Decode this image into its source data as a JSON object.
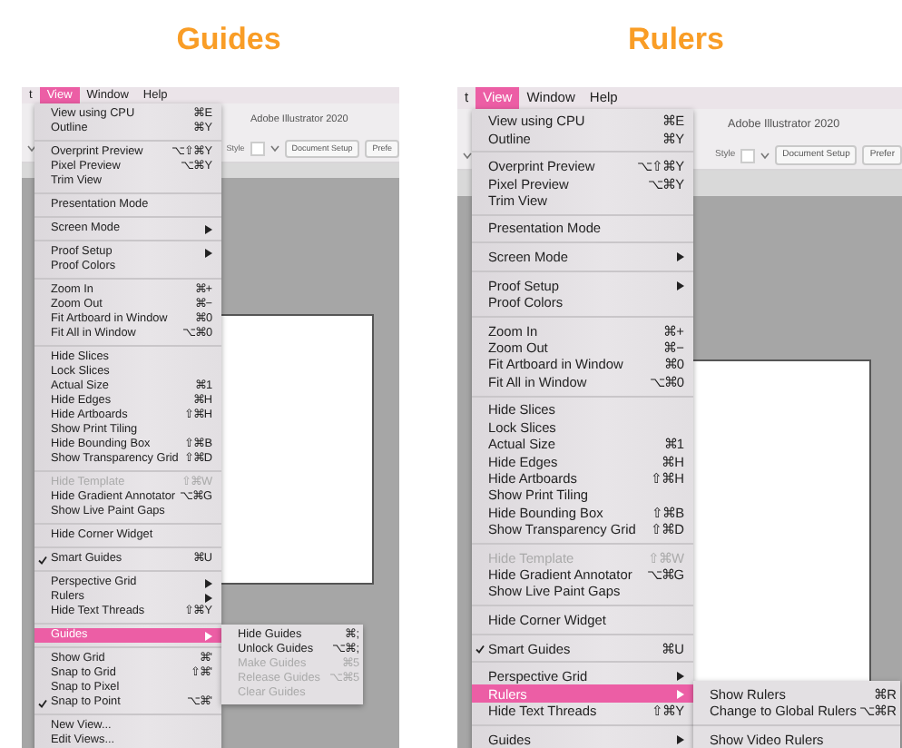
{
  "panels": [
    {
      "title": "Guides",
      "menubar": [
        {
          "label": "t",
          "selected": false
        },
        {
          "label": "View",
          "selected": true
        },
        {
          "label": "Window",
          "selected": false
        },
        {
          "label": "Help",
          "selected": false
        }
      ],
      "app": {
        "title": "Adobe Illustrator 2020",
        "style_label": "Style",
        "buttons": [
          "Document Setup",
          "Prefe"
        ]
      },
      "menu": [
        [
          {
            "label": "View using CPU",
            "shortcut": "⌘E"
          },
          {
            "label": "Outline",
            "shortcut": "⌘Y"
          }
        ],
        [
          {
            "label": "Overprint Preview",
            "shortcut": "⌥⇧⌘Y"
          },
          {
            "label": "Pixel Preview",
            "shortcut": "⌥⌘Y"
          },
          {
            "label": "Trim View"
          }
        ],
        [
          {
            "label": "Presentation Mode"
          }
        ],
        [
          {
            "label": "Screen Mode",
            "has_submenu": true
          }
        ],
        [
          {
            "label": "Proof Setup",
            "has_submenu": true
          },
          {
            "label": "Proof Colors"
          }
        ],
        [
          {
            "label": "Zoom In",
            "shortcut": "⌘+"
          },
          {
            "label": "Zoom Out",
            "shortcut": "⌘−"
          },
          {
            "label": "Fit Artboard in Window",
            "shortcut": "⌘0"
          },
          {
            "label": "Fit All in Window",
            "shortcut": "⌥⌘0"
          }
        ],
        [
          {
            "label": "Hide Slices"
          },
          {
            "label": "Lock Slices"
          },
          {
            "label": "Actual Size",
            "shortcut": "⌘1"
          },
          {
            "label": "Hide Edges",
            "shortcut": "⌘H"
          },
          {
            "label": "Hide Artboards",
            "shortcut": "⇧⌘H"
          },
          {
            "label": "Show Print Tiling"
          },
          {
            "label": "Hide Bounding Box",
            "shortcut": "⇧⌘B"
          },
          {
            "label": "Show Transparency Grid",
            "shortcut": "⇧⌘D"
          }
        ],
        [
          {
            "label": "Hide Template",
            "shortcut": "⇧⌘W",
            "disabled": true
          },
          {
            "label": "Hide Gradient Annotator",
            "shortcut": "⌥⌘G"
          },
          {
            "label": "Show Live Paint Gaps"
          }
        ],
        [
          {
            "label": "Hide Corner Widget"
          }
        ],
        [
          {
            "label": "Smart Guides",
            "shortcut": "⌘U",
            "checked": true
          }
        ],
        [
          {
            "label": "Perspective Grid",
            "has_submenu": true
          },
          {
            "label": "Rulers",
            "has_submenu": true
          },
          {
            "label": "Hide Text Threads",
            "shortcut": "⇧⌘Y"
          }
        ],
        [
          {
            "label": "Guides",
            "has_submenu": true,
            "selected": true
          }
        ],
        [
          {
            "label": "Show Grid",
            "shortcut": "⌘'"
          },
          {
            "label": "Snap to Grid",
            "shortcut": "⇧⌘'"
          },
          {
            "label": "Snap to Pixel"
          },
          {
            "label": "Snap to Point",
            "shortcut": "⌥⌘'",
            "checked": true
          }
        ],
        [
          {
            "label": "New View..."
          },
          {
            "label": "Edit Views..."
          }
        ]
      ],
      "submenu": [
        [
          {
            "label": "Hide Guides",
            "shortcut": "⌘;"
          },
          {
            "label": "Unlock Guides",
            "shortcut": "⌥⌘;"
          },
          {
            "label": "Make Guides",
            "shortcut": "⌘5",
            "disabled": true
          },
          {
            "label": "Release Guides",
            "shortcut": "⌥⌘5",
            "disabled": true
          },
          {
            "label": "Clear Guides",
            "disabled": true
          }
        ]
      ]
    },
    {
      "title": "Rulers",
      "menubar": [
        {
          "label": "t",
          "selected": false
        },
        {
          "label": "View",
          "selected": true
        },
        {
          "label": "Window",
          "selected": false
        },
        {
          "label": "Help",
          "selected": false
        }
      ],
      "app": {
        "title": "Adobe Illustrator 2020",
        "style_label": "Style",
        "buttons": [
          "Document Setup",
          "Prefer"
        ]
      },
      "menu": [
        [
          {
            "label": "View using CPU",
            "shortcut": "⌘E"
          },
          {
            "label": "Outline",
            "shortcut": "⌘Y"
          }
        ],
        [
          {
            "label": "Overprint Preview",
            "shortcut": "⌥⇧⌘Y"
          },
          {
            "label": "Pixel Preview",
            "shortcut": "⌥⌘Y"
          },
          {
            "label": "Trim View"
          }
        ],
        [
          {
            "label": "Presentation Mode"
          }
        ],
        [
          {
            "label": "Screen Mode",
            "has_submenu": true
          }
        ],
        [
          {
            "label": "Proof Setup",
            "has_submenu": true
          },
          {
            "label": "Proof Colors"
          }
        ],
        [
          {
            "label": "Zoom In",
            "shortcut": "⌘+"
          },
          {
            "label": "Zoom Out",
            "shortcut": "⌘−"
          },
          {
            "label": "Fit Artboard in Window",
            "shortcut": "⌘0"
          },
          {
            "label": "Fit All in Window",
            "shortcut": "⌥⌘0"
          }
        ],
        [
          {
            "label": "Hide Slices"
          },
          {
            "label": "Lock Slices"
          },
          {
            "label": "Actual Size",
            "shortcut": "⌘1"
          },
          {
            "label": "Hide Edges",
            "shortcut": "⌘H"
          },
          {
            "label": "Hide Artboards",
            "shortcut": "⇧⌘H"
          },
          {
            "label": "Show Print Tiling"
          },
          {
            "label": "Hide Bounding Box",
            "shortcut": "⇧⌘B"
          },
          {
            "label": "Show Transparency Grid",
            "shortcut": "⇧⌘D"
          }
        ],
        [
          {
            "label": "Hide Template",
            "shortcut": "⇧⌘W",
            "disabled": true
          },
          {
            "label": "Hide Gradient Annotator",
            "shortcut": "⌥⌘G"
          },
          {
            "label": "Show Live Paint Gaps"
          }
        ],
        [
          {
            "label": "Hide Corner Widget"
          }
        ],
        [
          {
            "label": "Smart Guides",
            "shortcut": "⌘U",
            "checked": true
          }
        ],
        [
          {
            "label": "Perspective Grid",
            "has_submenu": true
          },
          {
            "label": "Rulers",
            "has_submenu": true,
            "selected": true
          },
          {
            "label": "Hide Text Threads",
            "shortcut": "⇧⌘Y"
          }
        ],
        [
          {
            "label": "Guides",
            "has_submenu": true
          }
        ]
      ],
      "submenu": [
        [
          {
            "label": "Show Rulers",
            "shortcut": "⌘R"
          },
          {
            "label": "Change to Global Rulers",
            "shortcut": "⌥⌘R"
          }
        ],
        [
          {
            "label": "Show Video Rulers"
          }
        ]
      ]
    }
  ]
}
